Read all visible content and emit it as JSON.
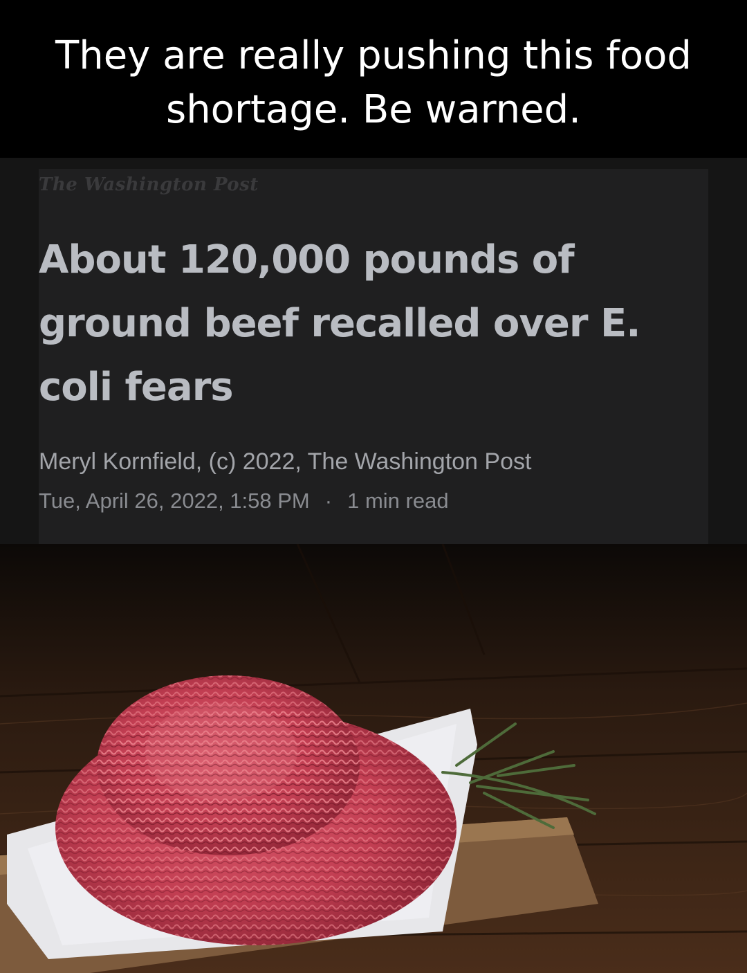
{
  "caption": {
    "line1": "They are really pushing this food",
    "line2": "shortage. Be warned."
  },
  "article": {
    "publication": "The Washington Post",
    "headline_line1": "About 120,000 pounds of",
    "headline_line2": "ground beef recalled over E.",
    "headline_line3": "coli fears",
    "byline": "Meryl Kornfield, (c) 2022, The Washington Post",
    "date": "Tue, April 26, 2022, 1:58 PM",
    "separator": "·",
    "read_time": "1 min read"
  },
  "photo": {
    "subject": "ground-beef-on-wooden-board-image"
  }
}
